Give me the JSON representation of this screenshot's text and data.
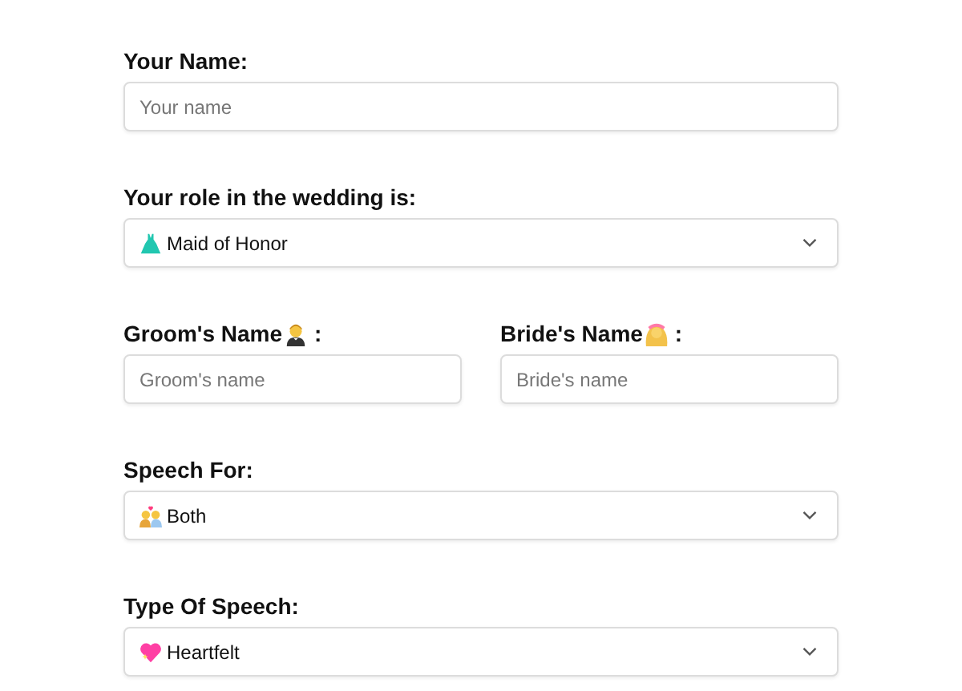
{
  "rows": [
    [
      {
        "kind": "text",
        "label": "Your Name:",
        "placeholder": "Your name"
      }
    ],
    [
      {
        "kind": "select",
        "label": "Your role in the wedding is:",
        "value": "Maid of Honor"
      }
    ],
    [
      {
        "kind": "text",
        "label": "Groom's Name",
        "label_suffix": ":",
        "placeholder": "Groom's name"
      },
      {
        "kind": "text",
        "label": "Bride's Name",
        "label_suffix": ":",
        "placeholder": "Bride's name"
      }
    ],
    [
      {
        "kind": "select",
        "label": "Speech For:",
        "value": "Both"
      }
    ],
    [
      {
        "kind": "select",
        "label": "Type Of Speech:",
        "value": "Heartfelt"
      }
    ]
  ]
}
